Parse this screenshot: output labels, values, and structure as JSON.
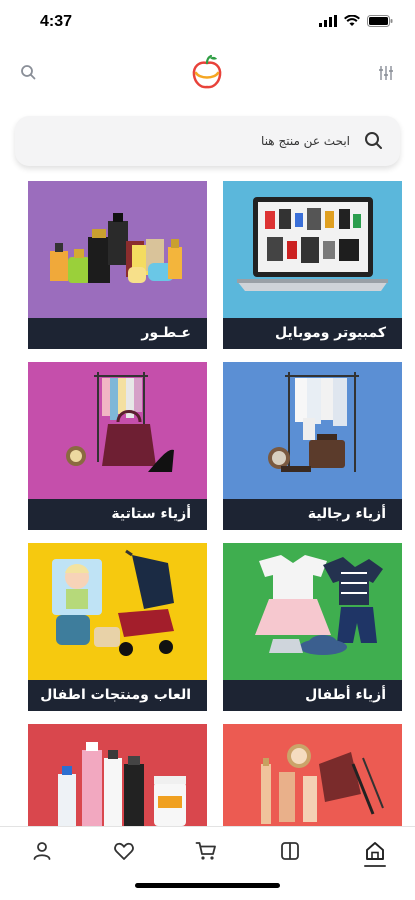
{
  "status": {
    "time": "4:37"
  },
  "header": {
    "icons": [
      "search-icon",
      "logo",
      "filter-icon"
    ]
  },
  "search": {
    "placeholder": "ابحث عن منتج هنا"
  },
  "categories": [
    {
      "label": "كمبيوتر وموبايل",
      "color": "#5bb7db"
    },
    {
      "label": "عـطـور",
      "color": "#9b6dbd"
    },
    {
      "label": "أزياء رجالية",
      "color": "#5b8fd4"
    },
    {
      "label": "أزياء ستاتية",
      "color": "#c54fab"
    },
    {
      "label": "أزياء أطفال",
      "color": "#3fae4f"
    },
    {
      "label": "العاب ومنتجات اطفال",
      "color": "#f6c90f"
    },
    {
      "label": "",
      "color": "#ec5b52"
    },
    {
      "label": "",
      "color": "#d9474d"
    }
  ],
  "bottom_nav": {
    "items": [
      "profile-icon",
      "favorites-icon",
      "cart-icon",
      "catalog-icon",
      "home-icon"
    ],
    "active": "home-icon"
  }
}
